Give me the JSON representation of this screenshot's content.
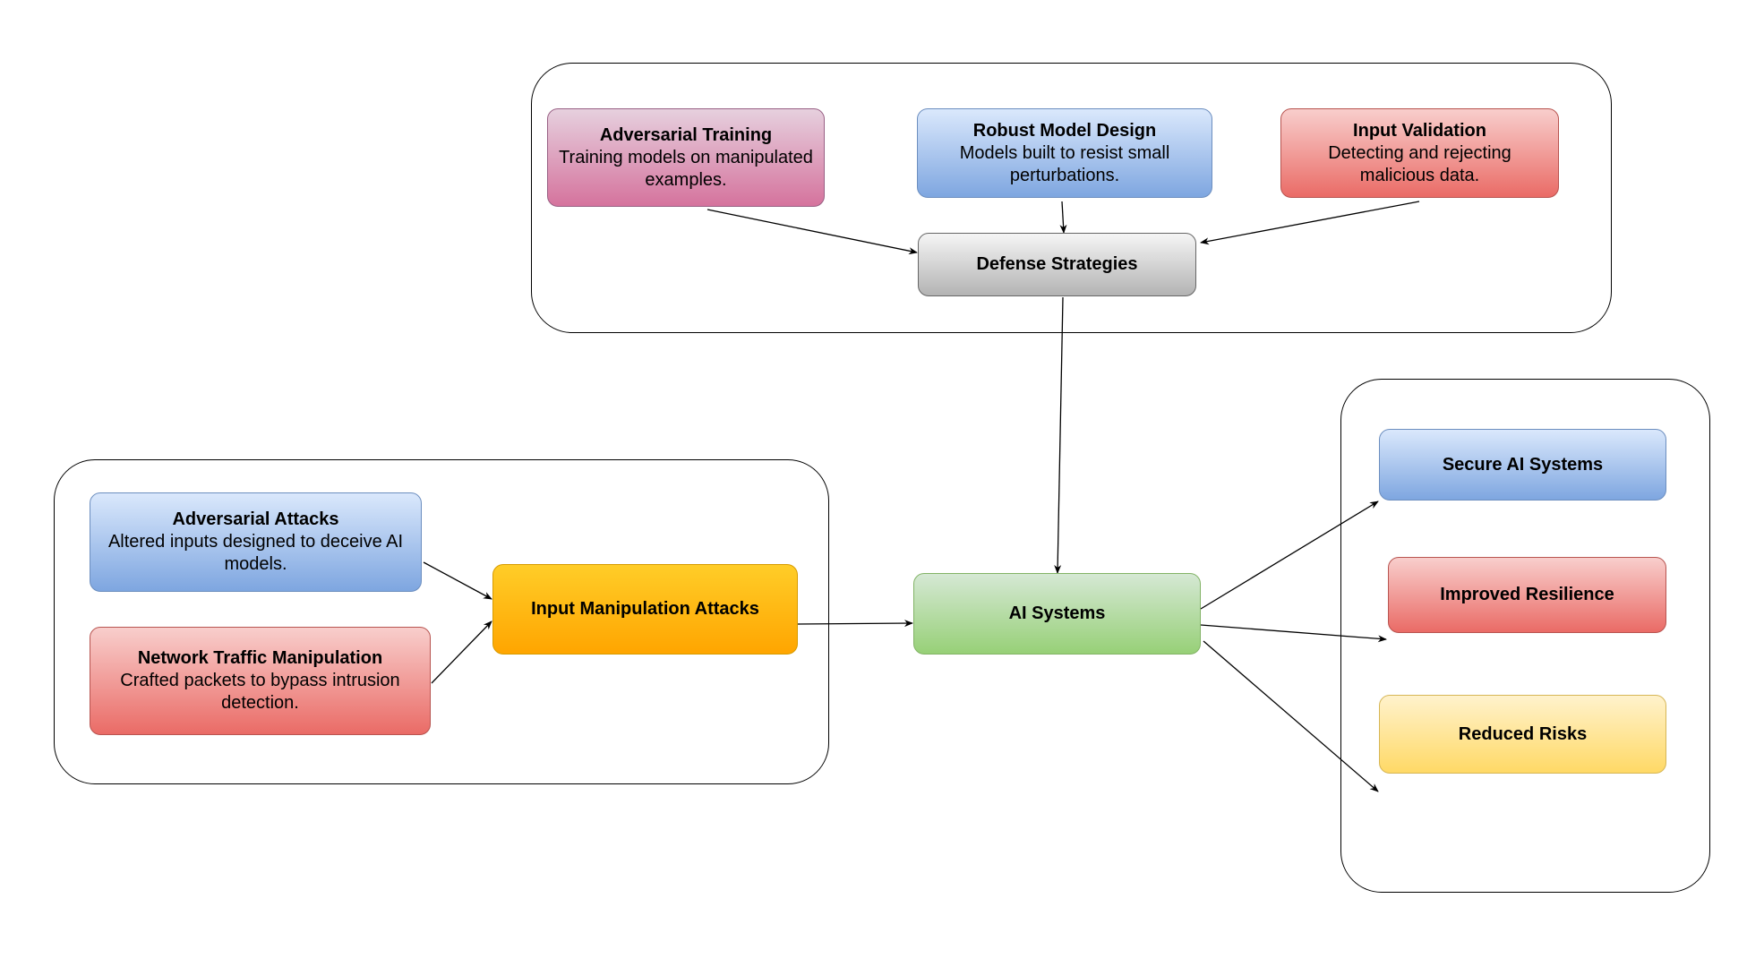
{
  "groups": {
    "defense": "defense-group",
    "attacks": "attacks-group",
    "outcomes": "outcomes-group"
  },
  "nodes": {
    "adversarial_training": {
      "title": "Adversarial Training",
      "desc": "Training models on manipulated examples."
    },
    "robust_model_design": {
      "title": "Robust Model Design",
      "desc": "Models built to resist small perturbations."
    },
    "input_validation": {
      "title": "Input Validation",
      "desc": "Detecting and rejecting malicious data."
    },
    "defense_strategies": {
      "title": "Defense Strategies"
    },
    "adversarial_attacks": {
      "title": "Adversarial Attacks",
      "desc": "Altered inputs designed to deceive AI models."
    },
    "network_traffic": {
      "title": "Network Traffic Manipulation",
      "desc": "Crafted packets to bypass intrusion detection."
    },
    "input_manipulation": {
      "title": "Input Manipulation Attacks"
    },
    "ai_systems": {
      "title": "AI Systems"
    },
    "secure_ai": {
      "title": "Secure AI Systems"
    },
    "improved_resilience": {
      "title": "Improved Resilience"
    },
    "reduced_risks": {
      "title": "Reduced Risks"
    }
  },
  "edges": [
    {
      "from": "Adversarial Training",
      "to": "Defense Strategies"
    },
    {
      "from": "Robust Model Design",
      "to": "Defense Strategies"
    },
    {
      "from": "Input Validation",
      "to": "Defense Strategies"
    },
    {
      "from": "Defense Strategies",
      "to": "AI Systems"
    },
    {
      "from": "Adversarial Attacks",
      "to": "Input Manipulation Attacks"
    },
    {
      "from": "Network Traffic Manipulation",
      "to": "Input Manipulation Attacks"
    },
    {
      "from": "Input Manipulation Attacks",
      "to": "AI Systems"
    },
    {
      "from": "AI Systems",
      "to": "Secure AI Systems"
    },
    {
      "from": "AI Systems",
      "to": "Improved Resilience"
    },
    {
      "from": "AI Systems",
      "to": "Reduced Risks"
    }
  ],
  "colors": {
    "pink": "#d5739d",
    "blue": "#7ea6e0",
    "red": "#ea6b66",
    "gray": "#b3b3b3",
    "orange": "#ffa500",
    "green": "#97d077",
    "yellow": "#ffd966"
  }
}
